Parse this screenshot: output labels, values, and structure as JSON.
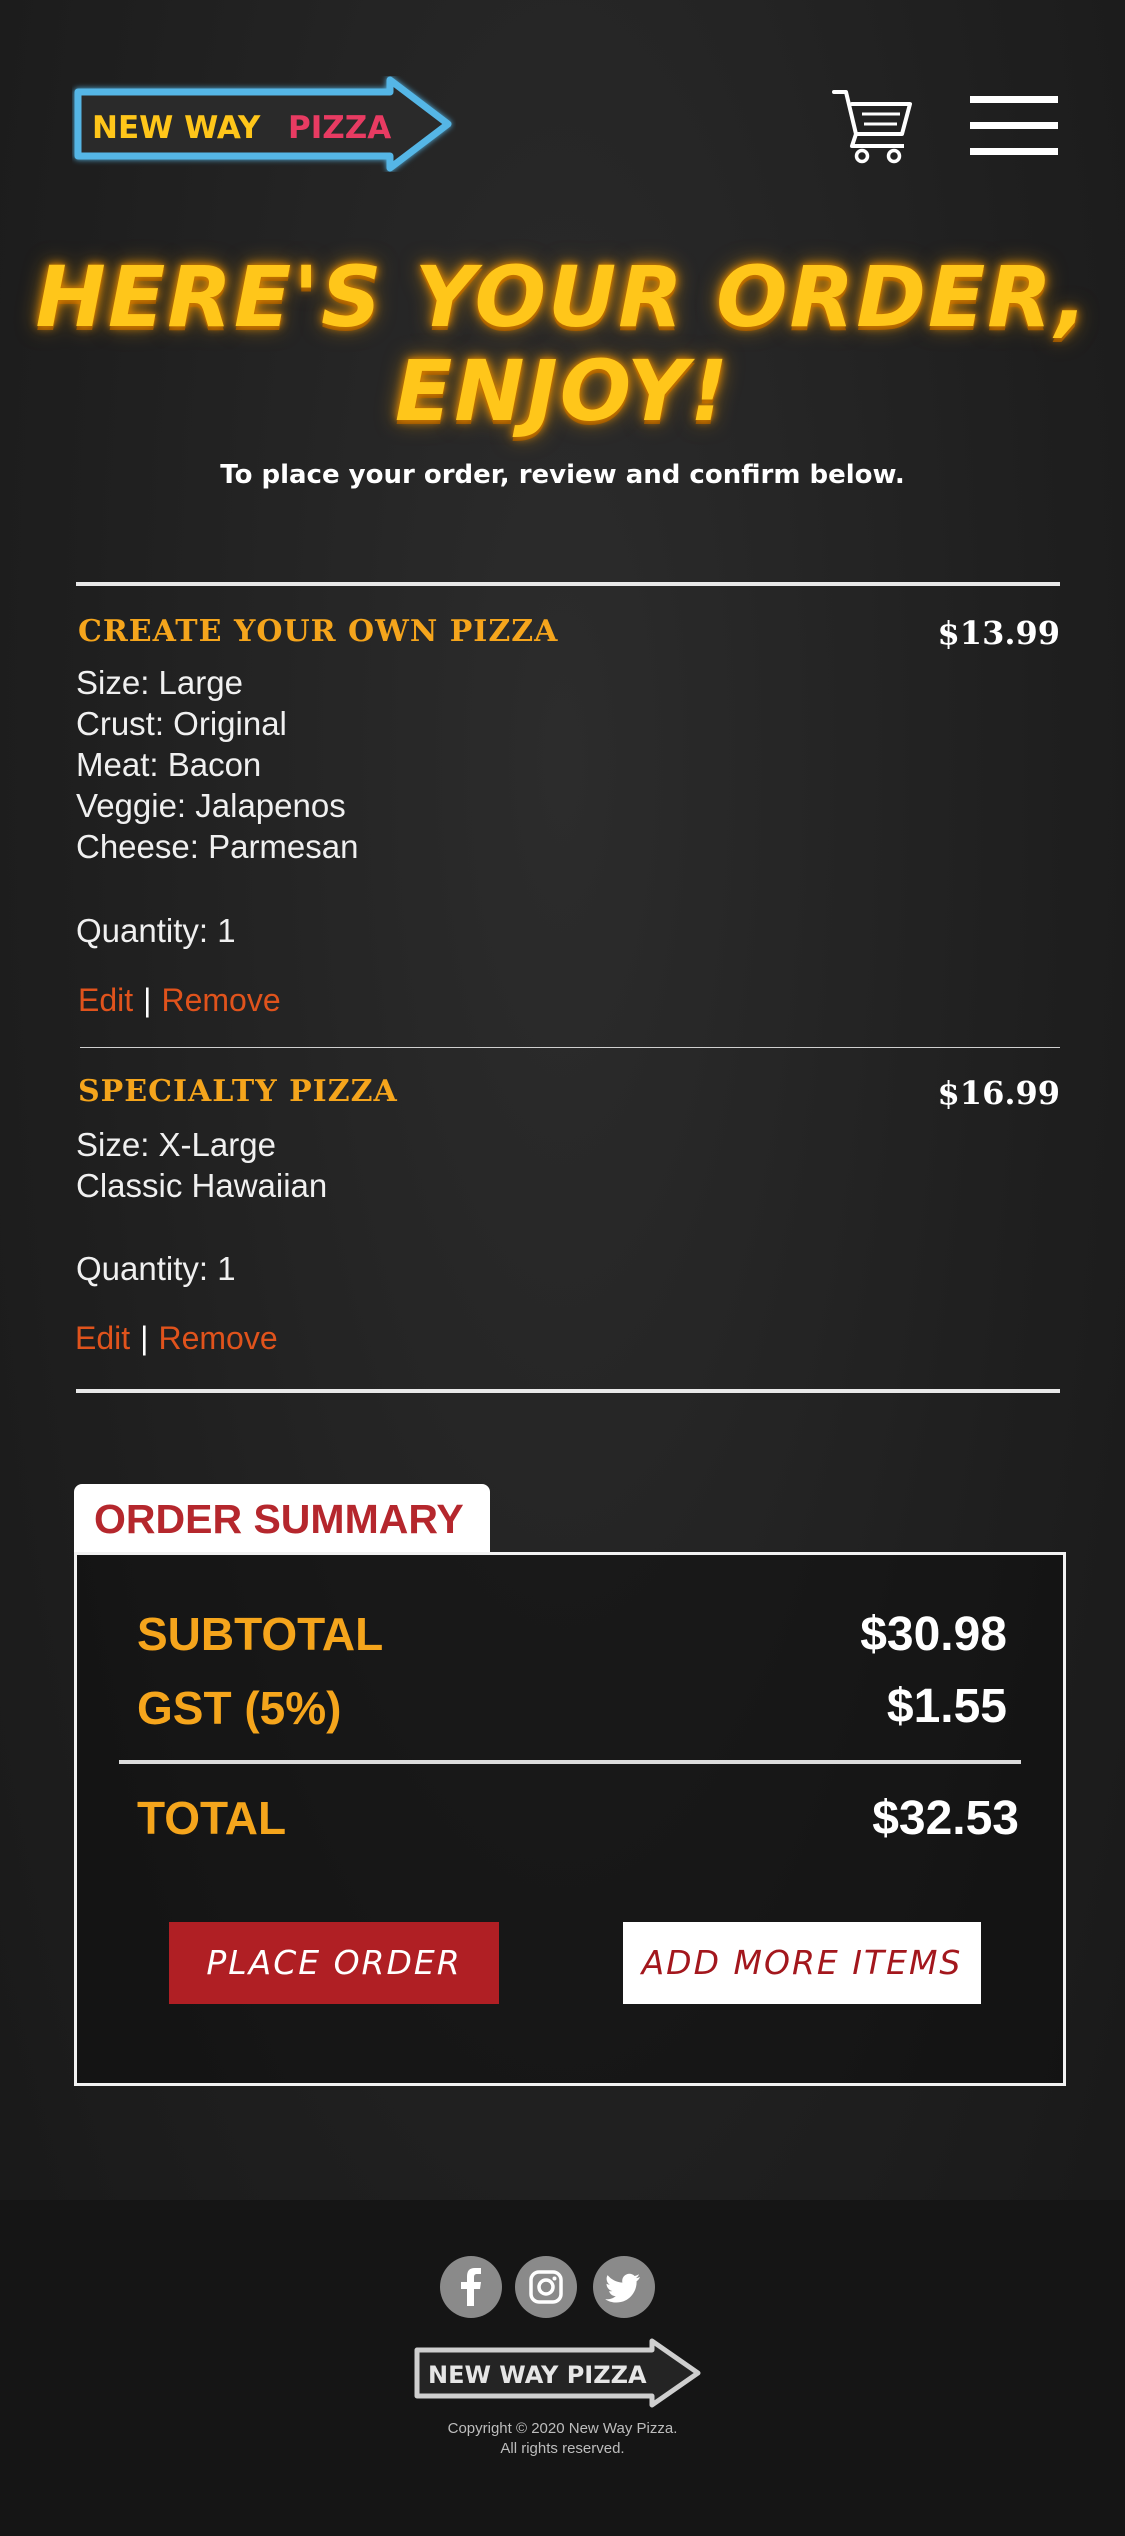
{
  "header": {
    "logo": {
      "text_primary": "NEW WAY",
      "text_accent": "PIZZA"
    },
    "icons": {
      "cart": "cart-icon",
      "menu": "hamburger-menu-icon"
    }
  },
  "hero": {
    "title_line1": "HERE'S YOUR ORDER,",
    "title_line2": "ENJOY!",
    "subtitle": "To place your order, review and confirm below."
  },
  "order": {
    "items": [
      {
        "name": "CREATE YOUR OWN PIZZA",
        "price": "$13.99",
        "details": [
          "Size: Large",
          "Crust: Original",
          "Meat: Bacon",
          "Veggie: Jalapenos",
          "Cheese: Parmesan"
        ],
        "quantity": "Quantity: 1",
        "edit_label": "Edit",
        "separator": "|",
        "remove_label": "Remove"
      },
      {
        "name": "SPECIALTY PIZZA",
        "price": "$16.99",
        "details": [
          "Size:  X-Large",
          "Classic Hawaiian"
        ],
        "quantity": "Quantity: 1",
        "edit_label": "Edit",
        "separator": "|",
        "remove_label": "Remove"
      }
    ]
  },
  "summary": {
    "tab_label": "ORDER SUMMARY",
    "subtotal_label": "SUBTOTAL",
    "subtotal_value": "$30.98",
    "gst_label": "GST (5%)",
    "gst_value": "$1.55",
    "total_label": "TOTAL",
    "total_value": "$32.53",
    "place_order_label": "PLACE ORDER",
    "add_more_label": "ADD MORE ITEMS"
  },
  "footer": {
    "social_icons": [
      "facebook-icon",
      "instagram-icon",
      "twitter-icon"
    ],
    "logo_text": "NEW WAY PIZZA",
    "copyright_line1": "Copyright © 2020 New Way Pizza.",
    "copyright_line2": "All rights reserved."
  },
  "colors": {
    "accent_yellow": "#f5a51c",
    "title_yellow": "#ffc61a",
    "action_orange": "#e0531c",
    "brand_red": "#b01f24",
    "logo_blue": "#54b6e6",
    "logo_pink": "#e83b62"
  }
}
